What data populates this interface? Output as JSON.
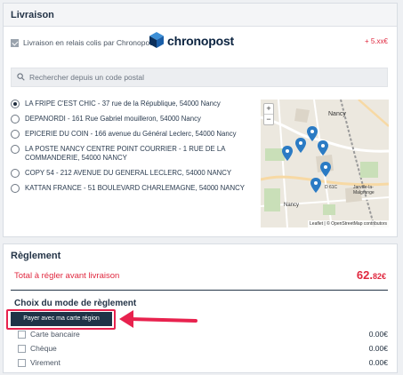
{
  "livraison": {
    "title": "Livraison",
    "carrier_label": "Livraison en relais colis par Chronopost",
    "carrier_checked": true,
    "brand_name": "chronopost",
    "price": "+ 5.xx€",
    "search_placeholder": "Rechercher depuis un code postal",
    "relays": [
      {
        "label": "LA FRIPE C'EST CHIC - 37 rue de la République, 54000 Nancy",
        "selected": true
      },
      {
        "label": "DEPANORDI - 161 Rue Gabriel mouilleron, 54000 Nancy",
        "selected": false
      },
      {
        "label": "EPICERIE DU COIN - 166 avenue du Général Leclerc, 54000 Nancy",
        "selected": false
      },
      {
        "label": "LA POSTE NANCY CENTRE POINT COURRIER - 1 RUE DE LA COMMANDERIE, 54000 NANCY",
        "selected": false
      },
      {
        "label": "COPY 54 - 212 AVENUE DU GENERAL LECLERC, 54000 NANCY",
        "selected": false
      },
      {
        "label": "KATTAN FRANCE - 51 BOULEVARD CHARLEMAGNE, 54000 NANCY",
        "selected": false
      }
    ],
    "map": {
      "zoom_in": "+",
      "zoom_out": "−",
      "attribution": "Leaflet | © OpenStreetMap contributors",
      "place_labels": [
        "Nancy",
        "Nancy",
        "Jarville-la-Malgrange",
        "D 61C"
      ]
    }
  },
  "reglement": {
    "title": "Règlement",
    "total_label": "Total à régler avant livraison",
    "total_amount_int": "62.",
    "total_amount_dec": "82€",
    "mode_title": "Choix du mode de règlement",
    "pay_button": "Payer avec ma carte région",
    "options": [
      {
        "label": "Carte bancaire",
        "amount": "0.00€"
      },
      {
        "label": "Chèque",
        "amount": "0.00€"
      },
      {
        "label": "Virement",
        "amount": "0.00€"
      }
    ]
  },
  "colors": {
    "accent_red": "#e0283f",
    "dark_navy": "#1f3347",
    "highlight_pink": "#e8224e",
    "map_pin": "#2b7bc4"
  }
}
